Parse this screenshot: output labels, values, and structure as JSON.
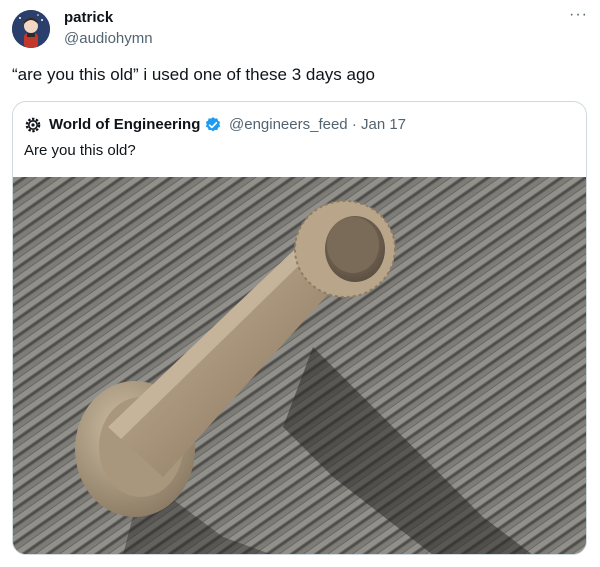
{
  "author": {
    "name": "patrick",
    "handle": "@audiohymn",
    "more_icon": "···"
  },
  "tweet": {
    "text": "“are you this old” i used one of these 3 days ago"
  },
  "quote": {
    "name": "World of Engineering",
    "handle_date": "@engineers_feed · Jan 17",
    "text": "Are you this old?",
    "verified_color": "#1d9bf0",
    "icon": "gear-logo-icon"
  },
  "media": {
    "subject": "window-crank-handle"
  }
}
